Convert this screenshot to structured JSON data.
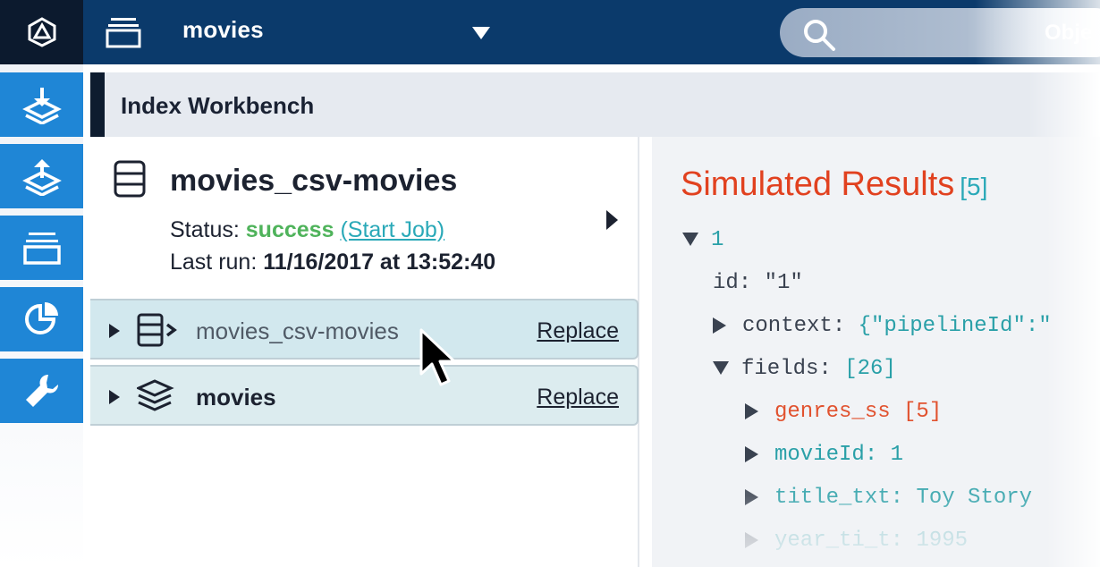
{
  "topbar": {
    "app_name": "movies",
    "search_placeholder": "Obje"
  },
  "nav": {
    "items": [
      {
        "icon": "datasource-import-icon"
      },
      {
        "icon": "pipeline-upload-icon"
      },
      {
        "icon": "collection-icon"
      },
      {
        "icon": "analytics-pie-icon"
      },
      {
        "icon": "wrench-icon"
      }
    ]
  },
  "workbench": {
    "title": "Index Workbench"
  },
  "job": {
    "name": "movies_csv-movies",
    "status_label": "Status:",
    "status_value": "success",
    "start_job": "(Start Job)",
    "last_run_label": "Last run:",
    "last_run_value": "11/16/2017 at 13:52:40"
  },
  "stages": [
    {
      "label": "movies_csv-movies",
      "action": "Replace",
      "icon": "datasource-icon"
    },
    {
      "label": "movies",
      "action": "Replace",
      "icon": "layers-icon"
    }
  ],
  "results": {
    "title": "Simulated Results",
    "count": "[5]",
    "tree": {
      "root": "1",
      "id_key": "id:",
      "id_val": "\"1\"",
      "context_key": "context:",
      "context_val": "{\"pipelineId\":\"",
      "fields_key": "fields:",
      "fields_val": "[26]",
      "genres": "genres_ss [5]",
      "movieid_key": "movieId:",
      "movieid_val": "1",
      "title_key": "title_txt:",
      "title_val": "Toy Story",
      "year_key": "year_ti_t:",
      "year_val": "1995"
    }
  },
  "colors": {
    "topbar": "#0b3a6b",
    "nav_button": "#1f86d6",
    "success": "#4fb35b",
    "accent_teal": "#2aa9b8",
    "results_title": "#e1411f"
  }
}
